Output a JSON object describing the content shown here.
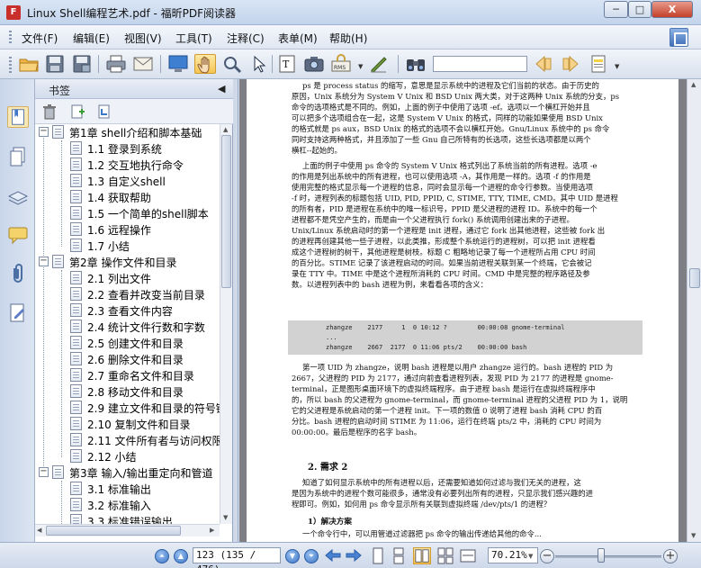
{
  "window": {
    "title": "Linux  Shell编程艺术.pdf - 福昕PDF阅读器",
    "app_icon": "pdf-app-icon",
    "controls": {
      "minimize": "─",
      "maximize": "□",
      "close": "X"
    }
  },
  "menu": {
    "items": [
      "文件(F)",
      "编辑(E)",
      "视图(V)",
      "工具(T)",
      "注释(C)",
      "表单(M)",
      "帮助(H)"
    ]
  },
  "toolbar": {
    "search_placeholder": "",
    "icons": [
      "open-folder-icon",
      "save-icon",
      "save-as-icon",
      "print-icon",
      "email-icon",
      "fullscreen-icon",
      "hand-tool-icon",
      "zoom-tool-icon",
      "select-arrow-icon",
      "text-select-icon",
      "snapshot-icon",
      "rms-icon",
      "sign-icon",
      "find-binoculars-icon",
      "prev-find-icon",
      "next-find-icon",
      "highlight-icon"
    ]
  },
  "sidebar": {
    "panel_title": "书签",
    "collapse_glyph": "◀",
    "strip_icons": [
      "bookmarks-icon",
      "pages-icon",
      "layers-icon",
      "comments-icon",
      "attachments-icon",
      "signatures-icon"
    ],
    "bookmarks": [
      {
        "label": "第1章 shell介绍和脚本基础",
        "level": 0,
        "expanded": true
      },
      {
        "label": "1.1 登录到系统",
        "level": 1
      },
      {
        "label": "1.2 交互地执行命令",
        "level": 1
      },
      {
        "label": "1.3 自定义shell",
        "level": 1
      },
      {
        "label": "1.4 获取帮助",
        "level": 1
      },
      {
        "label": "1.5 一个简单的shell脚本",
        "level": 1
      },
      {
        "label": "1.6 远程操作",
        "level": 1
      },
      {
        "label": "1.7 小结",
        "level": 1
      },
      {
        "label": "第2章 操作文件和目录",
        "level": 0,
        "expanded": true
      },
      {
        "label": "2.1 列出文件",
        "level": 1
      },
      {
        "label": "2.2 查看并改变当前目录",
        "level": 1
      },
      {
        "label": "2.3 查看文件内容",
        "level": 1
      },
      {
        "label": "2.4 统计文件行数和字数",
        "level": 1
      },
      {
        "label": "2.5 创建文件和目录",
        "level": 1
      },
      {
        "label": "2.6 删除文件和目录",
        "level": 1
      },
      {
        "label": "2.7 重命名文件和目录",
        "level": 1
      },
      {
        "label": "2.8 移动文件和目录",
        "level": 1
      },
      {
        "label": "2.9 建立文件和目录的符号链",
        "level": 1
      },
      {
        "label": "2.10 复制文件和目录",
        "level": 1
      },
      {
        "label": "2.11 文件所有者与访问权限",
        "level": 1
      },
      {
        "label": "2.12 小结",
        "level": 1
      },
      {
        "label": "第3章 输入/输出重定向和管道",
        "level": 0,
        "expanded": true
      },
      {
        "label": "3.1 标准输出",
        "level": 1
      },
      {
        "label": "3.2 标准输入",
        "level": 1
      },
      {
        "label": "3.3 标准错误输出",
        "level": 1
      }
    ]
  },
  "document": {
    "para1": [
      "ps 是 process status 的缩写，意思是显示系统中的进程及它们当前的状态。由于历史的",
      "原因，Unix 系统分为 System V Unix 和 BSD Unix 两大类，对于这两种 Unix 系统的分支，ps",
      "命令的选项格式是不同的。例如，上面的例子中使用了选项 -ef。选项以一个横杠开始并且",
      "可以把多个选项组合在一起，这是 System V Unix 的格式，同样的功能如果使用 BSD Unix",
      "的格式就是 ps aux，BSD Unix 的格式的选项不会以横杠开始。Gnu/Linux 系统中的 ps 命令",
      "同时支持这两种格式，并且添加了一些 Gnu 自己所特有的长选项，这些长选项都是以两个",
      "横杠--起始的。"
    ],
    "para2": [
      "上面的例子中使用 ps 命令的 System V Unix 格式列出了系统当前的所有进程。选项 -e",
      "的作用是列出系统中的所有进程，也可以使用选项 -A，其作用是一样的。选项 -f 的作用是",
      "使用完整的格式显示每一个进程的信息，同时会显示每一个进程的命令行参数。当使用选项",
      "-f 时，进程列表的标题包括 UID, PID, PPID, C, STIME, TTY, TIME, CMD。其中 UID 是进程",
      "的所有者，PID 是进程在系统中的唯一标识号，PPID 是父进程的进程 ID。系统中的每一个",
      "进程都不是凭空产生的，而是由一个父进程执行 fork() 系统调用创建出来的子进程。",
      "Unix/Linux 系统启动时的第一个进程是 init 进程，通过它 fork 出其他进程，这些被 fork 出",
      "的进程再创建其他一些子进程，以此类推，形成整个系统运行的进程树，可以把 init 进程看",
      "成这个进程树的树干，其他进程是树枝。标题 C 粗略地记录了每一个进程所占用 CPU 时间",
      "的百分比。STIME 记录了该进程启动的时间。如果当前进程关联到某一个终端，它会被记",
      "录在 TTY 中。TIME 中是这个进程所消耗的 CPU 时间。CMD 中是完整的程序路径及参",
      "数。以进程列表中的 bash 进程为例，来看看各项的含义："
    ],
    "code": [
      "zhangze    2177     1  0 10:12 ?        00:00:08 gnome-terminal",
      "...",
      "zhangze    2667  2177  0 11:06 pts/2    00:00:00 bash"
    ],
    "para3": [
      "第一项 UID 为 zhangze，说明 bash 进程是以用户 zhangze 运行的。bash 进程的 PID 为",
      "2667，父进程的 PID 为 2177，通过向前查看进程列表，发现 PID 为 2177 的进程是 gnome-",
      "terminal，正是图形桌面环境下的虚拟终端程序。由于进程 bash 是运行在虚拟终端程序中",
      "的，所以 bash 的父进程为 gnome-terminal，而 gnome-terminal 进程的父进程 PID 为 1，说明",
      "它的父进程是系统启动的第一个进程 init。下一项的数值 0 说明了进程 bash 消耗 CPU 的百",
      "分比。bash 进程的启动时间 STIME 为 11:06，运行在终端 pts/2 中，消耗的 CPU 时间为",
      "00:00:00。最后是程序的名字 bash。"
    ],
    "section_title": "2. 需求 2",
    "para4": [
      "知道了如何显示系统中的所有进程以后，还需要知道如何过滤与我们无关的进程，这",
      "是因为系统中的进程个数可能很多，通常没有必要列出所有的进程，只显示我们感兴趣的进",
      "程即可。例如，如何用 ps 命令显示所有关联到虚拟终端 /dev/pts/1 的进程？"
    ],
    "subsection_title": "1）解决方案",
    "para5": "一个命令行中，可以用管道过滤器把 ps 命令的输出传递给其他的命令..."
  },
  "statusbar": {
    "page_display": "123 (135 / 476)",
    "zoom_display": "70.21%",
    "zoom_minus": "−",
    "zoom_plus": "+",
    "zoom_level_percent": 70.21
  }
}
